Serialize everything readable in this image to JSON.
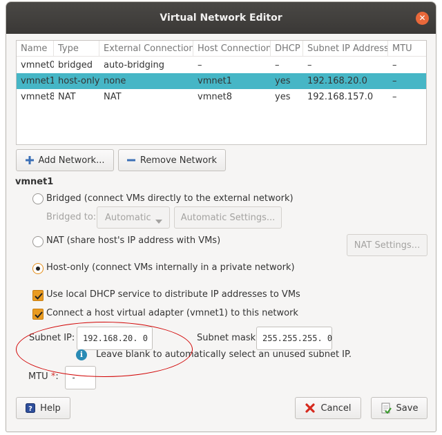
{
  "window": {
    "title": "Virtual Network Editor",
    "close_glyph": "✕"
  },
  "table": {
    "columns": [
      "Name",
      "Type",
      "External Connection",
      "Host Connection",
      "DHCP",
      "Subnet IP Address",
      "MTU"
    ],
    "rows": [
      [
        "vmnet0",
        "bridged",
        "auto-bridging",
        "–",
        "–",
        "–",
        "–"
      ],
      [
        "vmnet1",
        "host-only",
        "none",
        "vmnet1",
        "yes",
        "192.168.20.0",
        "–"
      ],
      [
        "vmnet8",
        "NAT",
        "NAT",
        "vmnet8",
        "yes",
        "192.168.157.0",
        "–"
      ]
    ],
    "selected_index": 1
  },
  "buttons": {
    "add_network": "Add Network...",
    "remove_network": "Remove Network",
    "automatic_settings": "Automatic Settings...",
    "nat_settings": "NAT Settings...",
    "help": "Help",
    "cancel": "Cancel",
    "save": "Save"
  },
  "section_title": "vmnet1",
  "options": {
    "bridged": "Bridged (connect VMs directly to the external network)",
    "bridged_to_label": "Bridged to:",
    "bridged_to_value": "Automatic",
    "nat": "NAT (share host's IP address with VMs)",
    "host_only": "Host-only (connect VMs internally in a private network)",
    "selected": "host_only",
    "use_dhcp": "Use local DHCP service to distribute IP addresses to VMs",
    "use_dhcp_checked": true,
    "connect_adapter": "Connect a host virtual adapter (vmnet1) to this network",
    "connect_adapter_checked": true
  },
  "subnet": {
    "ip_label": "Subnet IP:",
    "ip_value": "192.168.20. 0",
    "mask_label": "Subnet mask:",
    "mask_value": "255.255.255. 0",
    "hint": "Leave blank to automatically select an unused subnet IP."
  },
  "mtu": {
    "label": "MTU",
    "required_mark": "*",
    "colon": ":",
    "value": "-"
  },
  "icons": {
    "add": "plus-icon",
    "remove": "minus-icon",
    "dropdown": "chevron-down-icon",
    "info": "info-icon",
    "help": "help-icon",
    "cancel": "x-icon",
    "save": "save-icon"
  },
  "colors": {
    "titlebar": "#3f3d3b",
    "selection": "#46b6c6",
    "accent": "#e99b21",
    "close": "#e9683a",
    "annotation": "#d10000"
  }
}
